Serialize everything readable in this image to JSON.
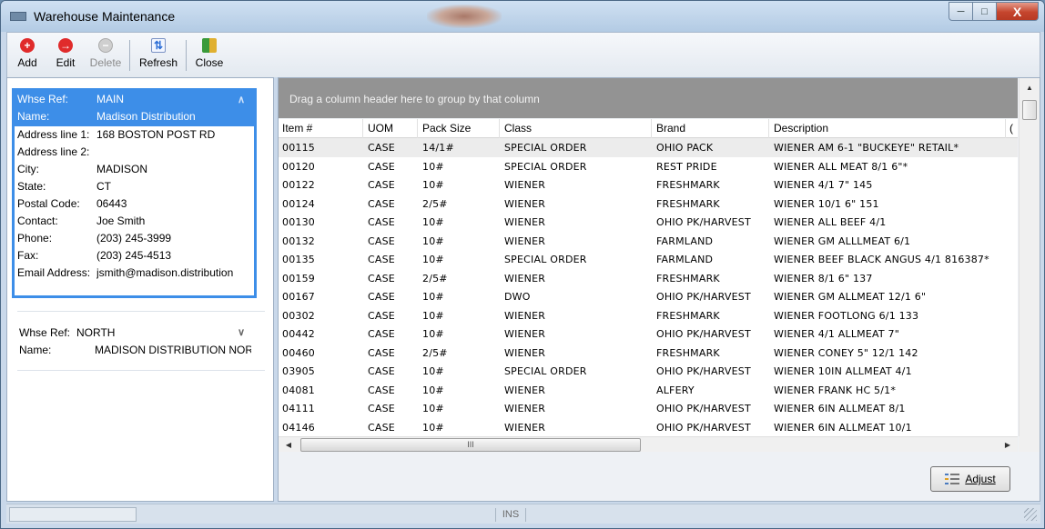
{
  "window": {
    "title": "Warehouse Maintenance",
    "minimize_label": "─",
    "maximize_label": "□",
    "close_label": "X"
  },
  "toolbar": {
    "add": {
      "label": "Add",
      "icon": "add-icon",
      "color": "#e02b2b"
    },
    "edit": {
      "label": "Edit",
      "icon": "edit-icon",
      "color": "#e02b2b"
    },
    "delete": {
      "label": "Delete",
      "icon": "delete-icon",
      "color": "#bdbdbd"
    },
    "refresh": {
      "label": "Refresh",
      "icon": "refresh-icon",
      "color": "#2e6fd6"
    },
    "close": {
      "label": "Close",
      "icon": "close-door-icon",
      "color": "#3a9a3a"
    }
  },
  "warehouses": [
    {
      "ref_label": "Whse Ref:",
      "ref": "MAIN",
      "name_label": "Name:",
      "name": "Madison Distribution",
      "selected": true,
      "fields": [
        {
          "label": "Address line 1:",
          "value": "168 BOSTON POST RD"
        },
        {
          "label": "Address line 2:",
          "value": ""
        },
        {
          "label": "City:",
          "value": "MADISON"
        },
        {
          "label": "State:",
          "value": "CT"
        },
        {
          "label": "Postal Code:",
          "value": "06443"
        },
        {
          "label": "Contact:",
          "value": "Joe Smith"
        },
        {
          "label": "Phone:",
          "value": "(203) 245-3999"
        },
        {
          "label": "Fax:",
          "value": "(203) 245-4513"
        },
        {
          "label": "Email Address:",
          "value": "jsmith@madison.distribution"
        }
      ]
    },
    {
      "ref_label": "Whse Ref:",
      "ref": "NORTH",
      "name_label": "Name:",
      "name": "MADISON DISTRIBUTION NORTH",
      "selected": false
    }
  ],
  "grid": {
    "group_hint": "Drag a column header here to group by that column",
    "columns": [
      "Item #",
      "UOM",
      "Pack Size",
      "Class",
      "Brand",
      "Description",
      "("
    ],
    "rows": [
      [
        "00115",
        "CASE",
        "14/1#",
        "SPECIAL ORDER",
        "OHIO PACK",
        "WIENER AM 6-1 \"BUCKEYE\" RETAIL*"
      ],
      [
        "00120",
        "CASE",
        "10#",
        "SPECIAL ORDER",
        "REST PRIDE",
        "WIENER ALL MEAT 8/1 6\"*"
      ],
      [
        "00122",
        "CASE",
        "10#",
        "WIENER",
        "FRESHMARK",
        "WIENER 4/1 7\" 145"
      ],
      [
        "00124",
        "CASE",
        "2/5#",
        "WIENER",
        "FRESHMARK",
        "WIENER 10/1 6\" 151"
      ],
      [
        "00130",
        "CASE",
        "10#",
        "WIENER",
        "OHIO PK/HARVEST",
        "WIENER ALL BEEF 4/1"
      ],
      [
        "00132",
        "CASE",
        "10#",
        "WIENER",
        "FARMLAND",
        "WIENER GM ALLLMEAT 6/1"
      ],
      [
        "00135",
        "CASE",
        "10#",
        "SPECIAL ORDER",
        "FARMLAND",
        "WIENER BEEF BLACK ANGUS 4/1 816387*"
      ],
      [
        "00159",
        "CASE",
        "2/5#",
        "WIENER",
        "FRESHMARK",
        "WIENER 8/1 6\" 137"
      ],
      [
        "00167",
        "CASE",
        "10#",
        "DWO",
        "OHIO PK/HARVEST",
        "WIENER GM ALLMEAT 12/1 6\""
      ],
      [
        "00302",
        "CASE",
        "10#",
        "WIENER",
        "FRESHMARK",
        "WIENER FOOTLONG 6/1 133"
      ],
      [
        "00442",
        "CASE",
        "10#",
        "WIENER",
        "OHIO PK/HARVEST",
        "WIENER 4/1 ALLMEAT 7\""
      ],
      [
        "00460",
        "CASE",
        "2/5#",
        "WIENER",
        "FRESHMARK",
        "WIENER CONEY 5\" 12/1 142"
      ],
      [
        "03905",
        "CASE",
        "10#",
        "SPECIAL ORDER",
        "OHIO PK/HARVEST",
        "WIENER 10IN ALLMEAT 4/1"
      ],
      [
        "04081",
        "CASE",
        "10#",
        "WIENER",
        "ALFERY",
        "WIENER FRANK HC 5/1*"
      ],
      [
        "04111",
        "CASE",
        "10#",
        "WIENER",
        "OHIO PK/HARVEST",
        "WIENER 6IN ALLMEAT 8/1"
      ],
      [
        "04146",
        "CASE",
        "10#",
        "WIENER",
        "OHIO PK/HARVEST",
        "WIENER 6IN ALLMEAT 10/1"
      ]
    ],
    "scroll_grip": "III"
  },
  "adjust_button": {
    "label": "Adjust"
  },
  "statusbar": {
    "ins": "INS"
  }
}
